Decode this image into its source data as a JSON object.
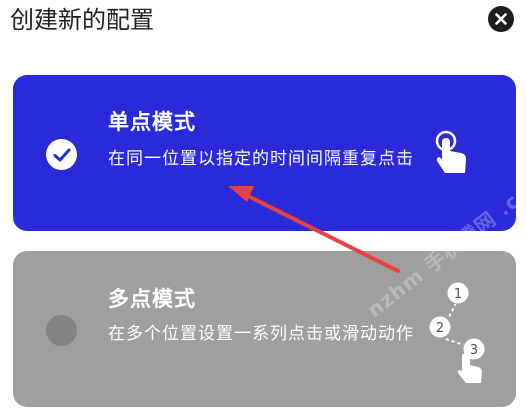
{
  "dialog": {
    "title": "创建新的配置",
    "close_icon": "close-icon"
  },
  "modes": {
    "single": {
      "title": "单点模式",
      "description": "在同一位置以指定的时间间隔重复点击",
      "selected": true,
      "icon": "tap-finger-icon",
      "color": "#2a2ad8"
    },
    "multi": {
      "title": "多点模式",
      "description": "在多个位置设置一系列点击或滑动动作",
      "selected": false,
      "icon": "multi-tap-icon",
      "step_labels": [
        "1",
        "2",
        "3"
      ],
      "color": "#9f9f9f"
    }
  },
  "annotation": {
    "arrow_color": "#e8413e"
  },
  "watermark": {
    "text": "nzhm 手机腾网 .com"
  }
}
